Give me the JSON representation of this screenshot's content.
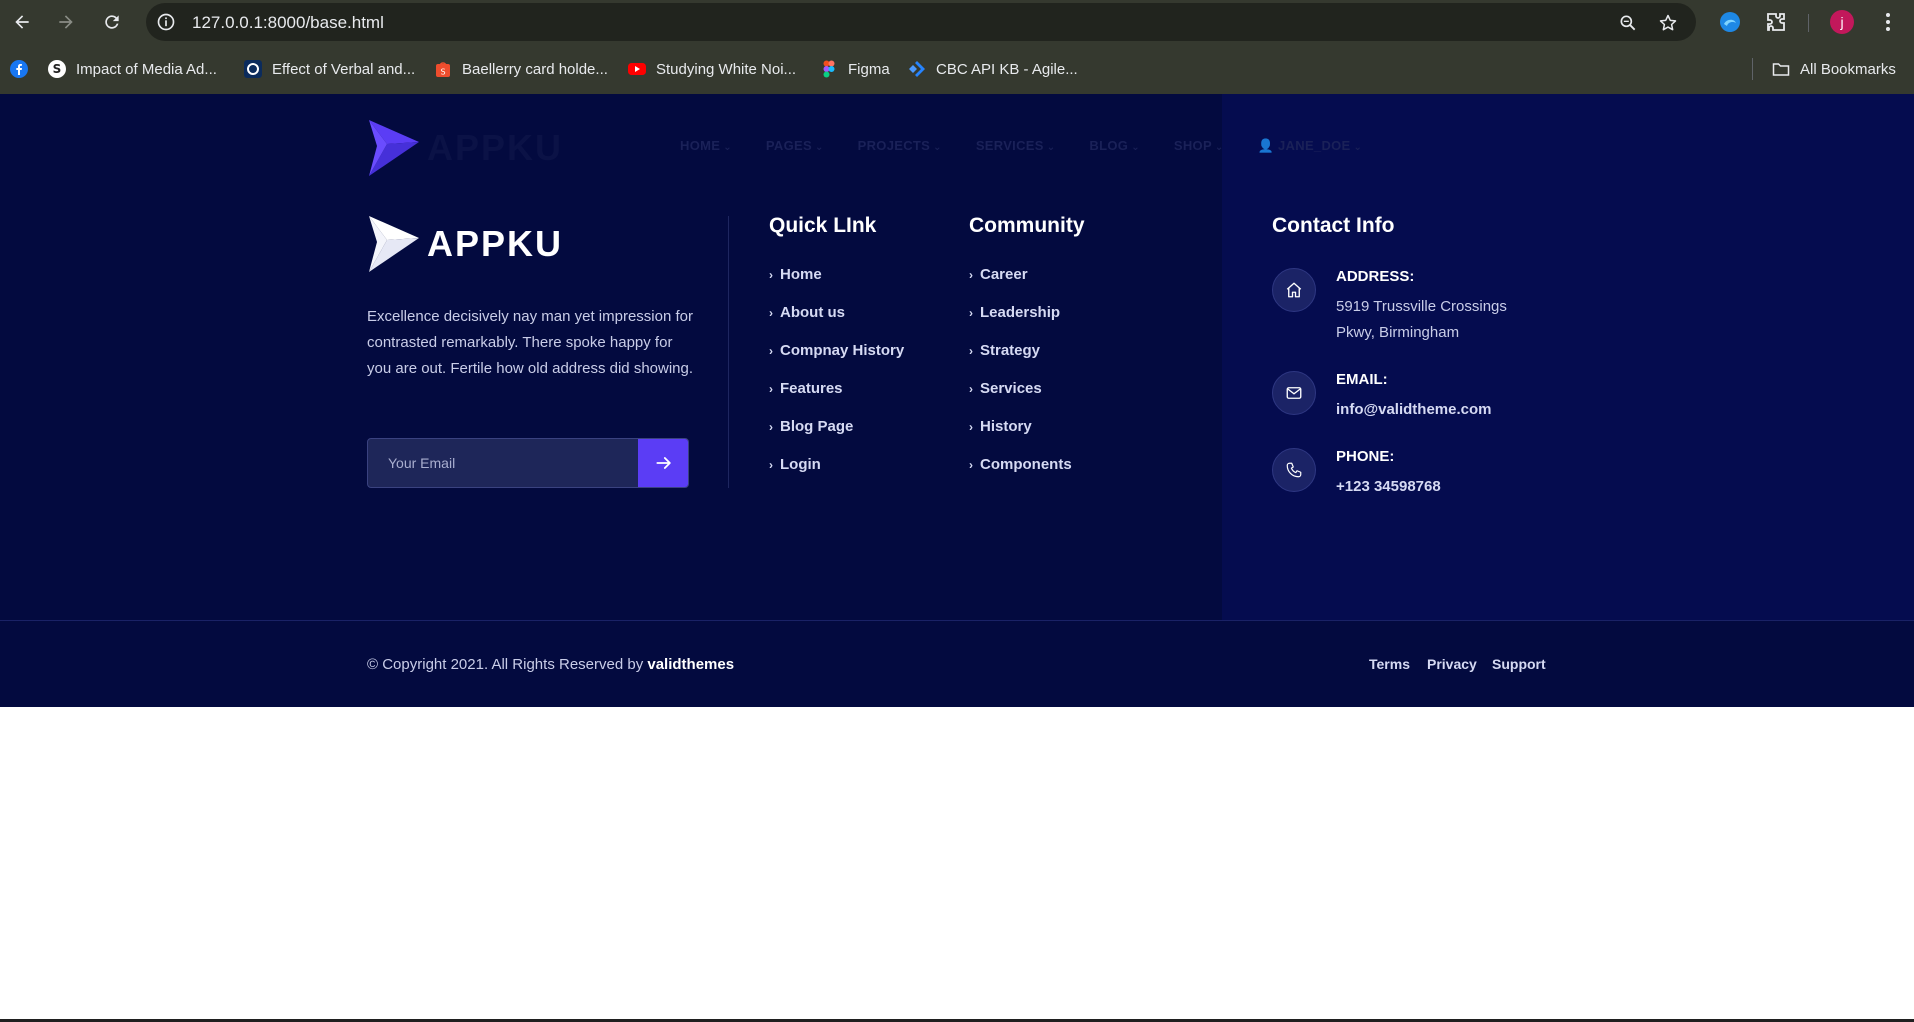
{
  "browser": {
    "url": "127.0.0.1:8000/base.html",
    "profile_initial": "j",
    "bookmarks": [
      {
        "label": "Impact of Media Ad...",
        "icon": "s-icon"
      },
      {
        "label": "Effect of Verbal and...",
        "icon": "o-icon"
      },
      {
        "label": "Baellerry card holde...",
        "icon": "shopee-icon"
      },
      {
        "label": "Studying White Noi...",
        "icon": "youtube-icon"
      },
      {
        "label": "Figma",
        "icon": "figma-icon"
      },
      {
        "label": "CBC API KB - Agile...",
        "icon": "jira-icon"
      }
    ],
    "all_bookmarks": "All Bookmarks"
  },
  "header": {
    "logo_text": "APPKU",
    "nav": [
      "HOME",
      "PAGES",
      "PROJECTS",
      "SERVICES",
      "BLOG",
      "SHOP",
      "JANE_DOE"
    ]
  },
  "footer": {
    "logo_text": "APPKU",
    "about": "Excellence decisively nay man yet impression for contrasted remarkably. There spoke happy for you are out. Fertile how old address did showing.",
    "email_placeholder": "Your Email",
    "quick_link": {
      "title": "Quick LInk",
      "items": [
        "Home",
        "About us",
        "Compnay History",
        "Features",
        "Blog Page",
        "Login"
      ]
    },
    "community": {
      "title": "Community",
      "items": [
        "Career",
        "Leadership",
        "Strategy",
        "Services",
        "History",
        "Components"
      ]
    },
    "contact": {
      "title": "Contact Info",
      "address_label": "ADDRESS:",
      "address_line1": "5919 Trussville Crossings",
      "address_line2": "Pkwy, Birmingham",
      "email_label": "EMAIL:",
      "email_value": "info@validtheme.com",
      "phone_label": "PHONE:",
      "phone_value": "+123 34598768"
    },
    "copyright_prefix": "© Copyright 2021. All Rights Reserved by ",
    "copyright_brand": "validthemes",
    "legal": [
      "Terms",
      "Privacy",
      "Support"
    ]
  },
  "colors": {
    "page_bg": "#030a3f",
    "panel_bg": "#050c4f",
    "accent": "#5b3df5"
  }
}
